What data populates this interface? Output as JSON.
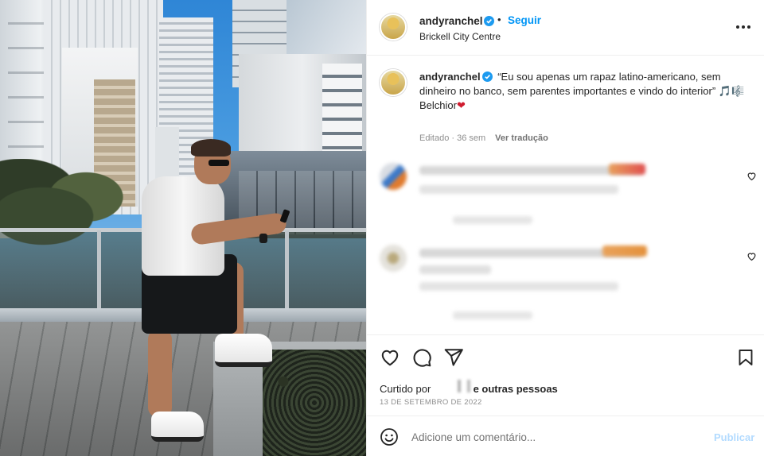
{
  "post": {
    "username": "andyranchel",
    "follow_label": "Seguir",
    "separator": "•",
    "location": "Brickell City Centre",
    "more_icon": "more-horizontal-icon"
  },
  "caption": {
    "username": "andyranchel",
    "text": "“Eu sou apenas um rapaz latino-americano, sem dinheiro no banco, sem parentes importantes e vindo do interior”",
    "emojis": "🎵🎼",
    "signature": "Belchior",
    "heart": "❤",
    "edited": "Editado · 36 sem",
    "translate": "Ver tradução"
  },
  "actions": {
    "like_icon": "heart-icon",
    "comment_icon": "comment-icon",
    "share_icon": "send-icon",
    "save_icon": "bookmark-icon"
  },
  "likes": {
    "prefix": "Curtido por",
    "suffix": "e outras pessoas"
  },
  "date": "13 DE SETEMBRO DE 2022",
  "comment_box": {
    "placeholder": "Adicione um comentário...",
    "publish": "Publicar",
    "emoji_icon": "smiley-icon"
  },
  "colors": {
    "link_blue": "#0095f6",
    "publish_disabled": "#b3dbff",
    "verified_blue": "#1d9bf0",
    "text": "#262626",
    "muted": "#8e8e8e"
  }
}
